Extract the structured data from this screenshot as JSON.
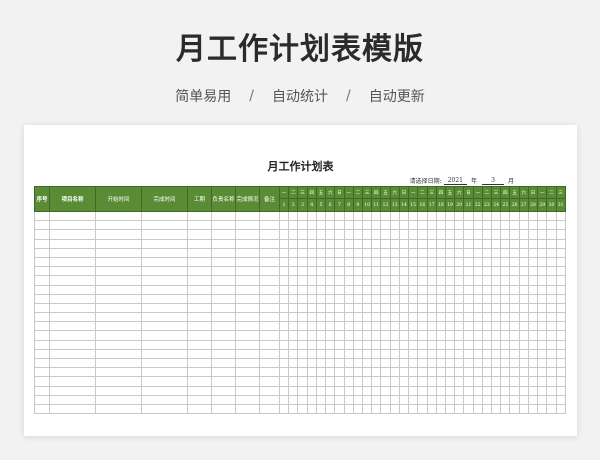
{
  "banner": {
    "title": "月工作计划表模版",
    "features": [
      "简单易用",
      "自动统计",
      "自动更新"
    ],
    "separator": "/"
  },
  "sheet": {
    "title": "月工作计划表",
    "date": {
      "prompt": "请选择日期:",
      "year": "2021",
      "year_unit": "年",
      "month": "3",
      "month_unit": "月"
    },
    "headers": [
      "序号",
      "项目名称",
      "开始时间",
      "完成时间",
      "工期",
      "负责名称",
      "完成情况",
      "备注"
    ],
    "weekdays": [
      "一",
      "二",
      "三",
      "四",
      "五",
      "六",
      "日",
      "一",
      "二",
      "三",
      "四",
      "五",
      "六",
      "日",
      "一",
      "二",
      "三",
      "四",
      "五",
      "六",
      "日",
      "一",
      "二",
      "三",
      "四",
      "五",
      "六",
      "日",
      "一",
      "二",
      "三"
    ],
    "days": [
      "1",
      "2",
      "3",
      "4",
      "5",
      "6",
      "7",
      "8",
      "9",
      "10",
      "11",
      "12",
      "13",
      "14",
      "15",
      "16",
      "17",
      "18",
      "19",
      "20",
      "21",
      "22",
      "23",
      "24",
      "25",
      "26",
      "27",
      "28",
      "29",
      "30",
      "31"
    ],
    "empty_rows": 22
  },
  "colors": {
    "header_green": "#5a8c35",
    "grid_line": "#c9c9c9"
  }
}
